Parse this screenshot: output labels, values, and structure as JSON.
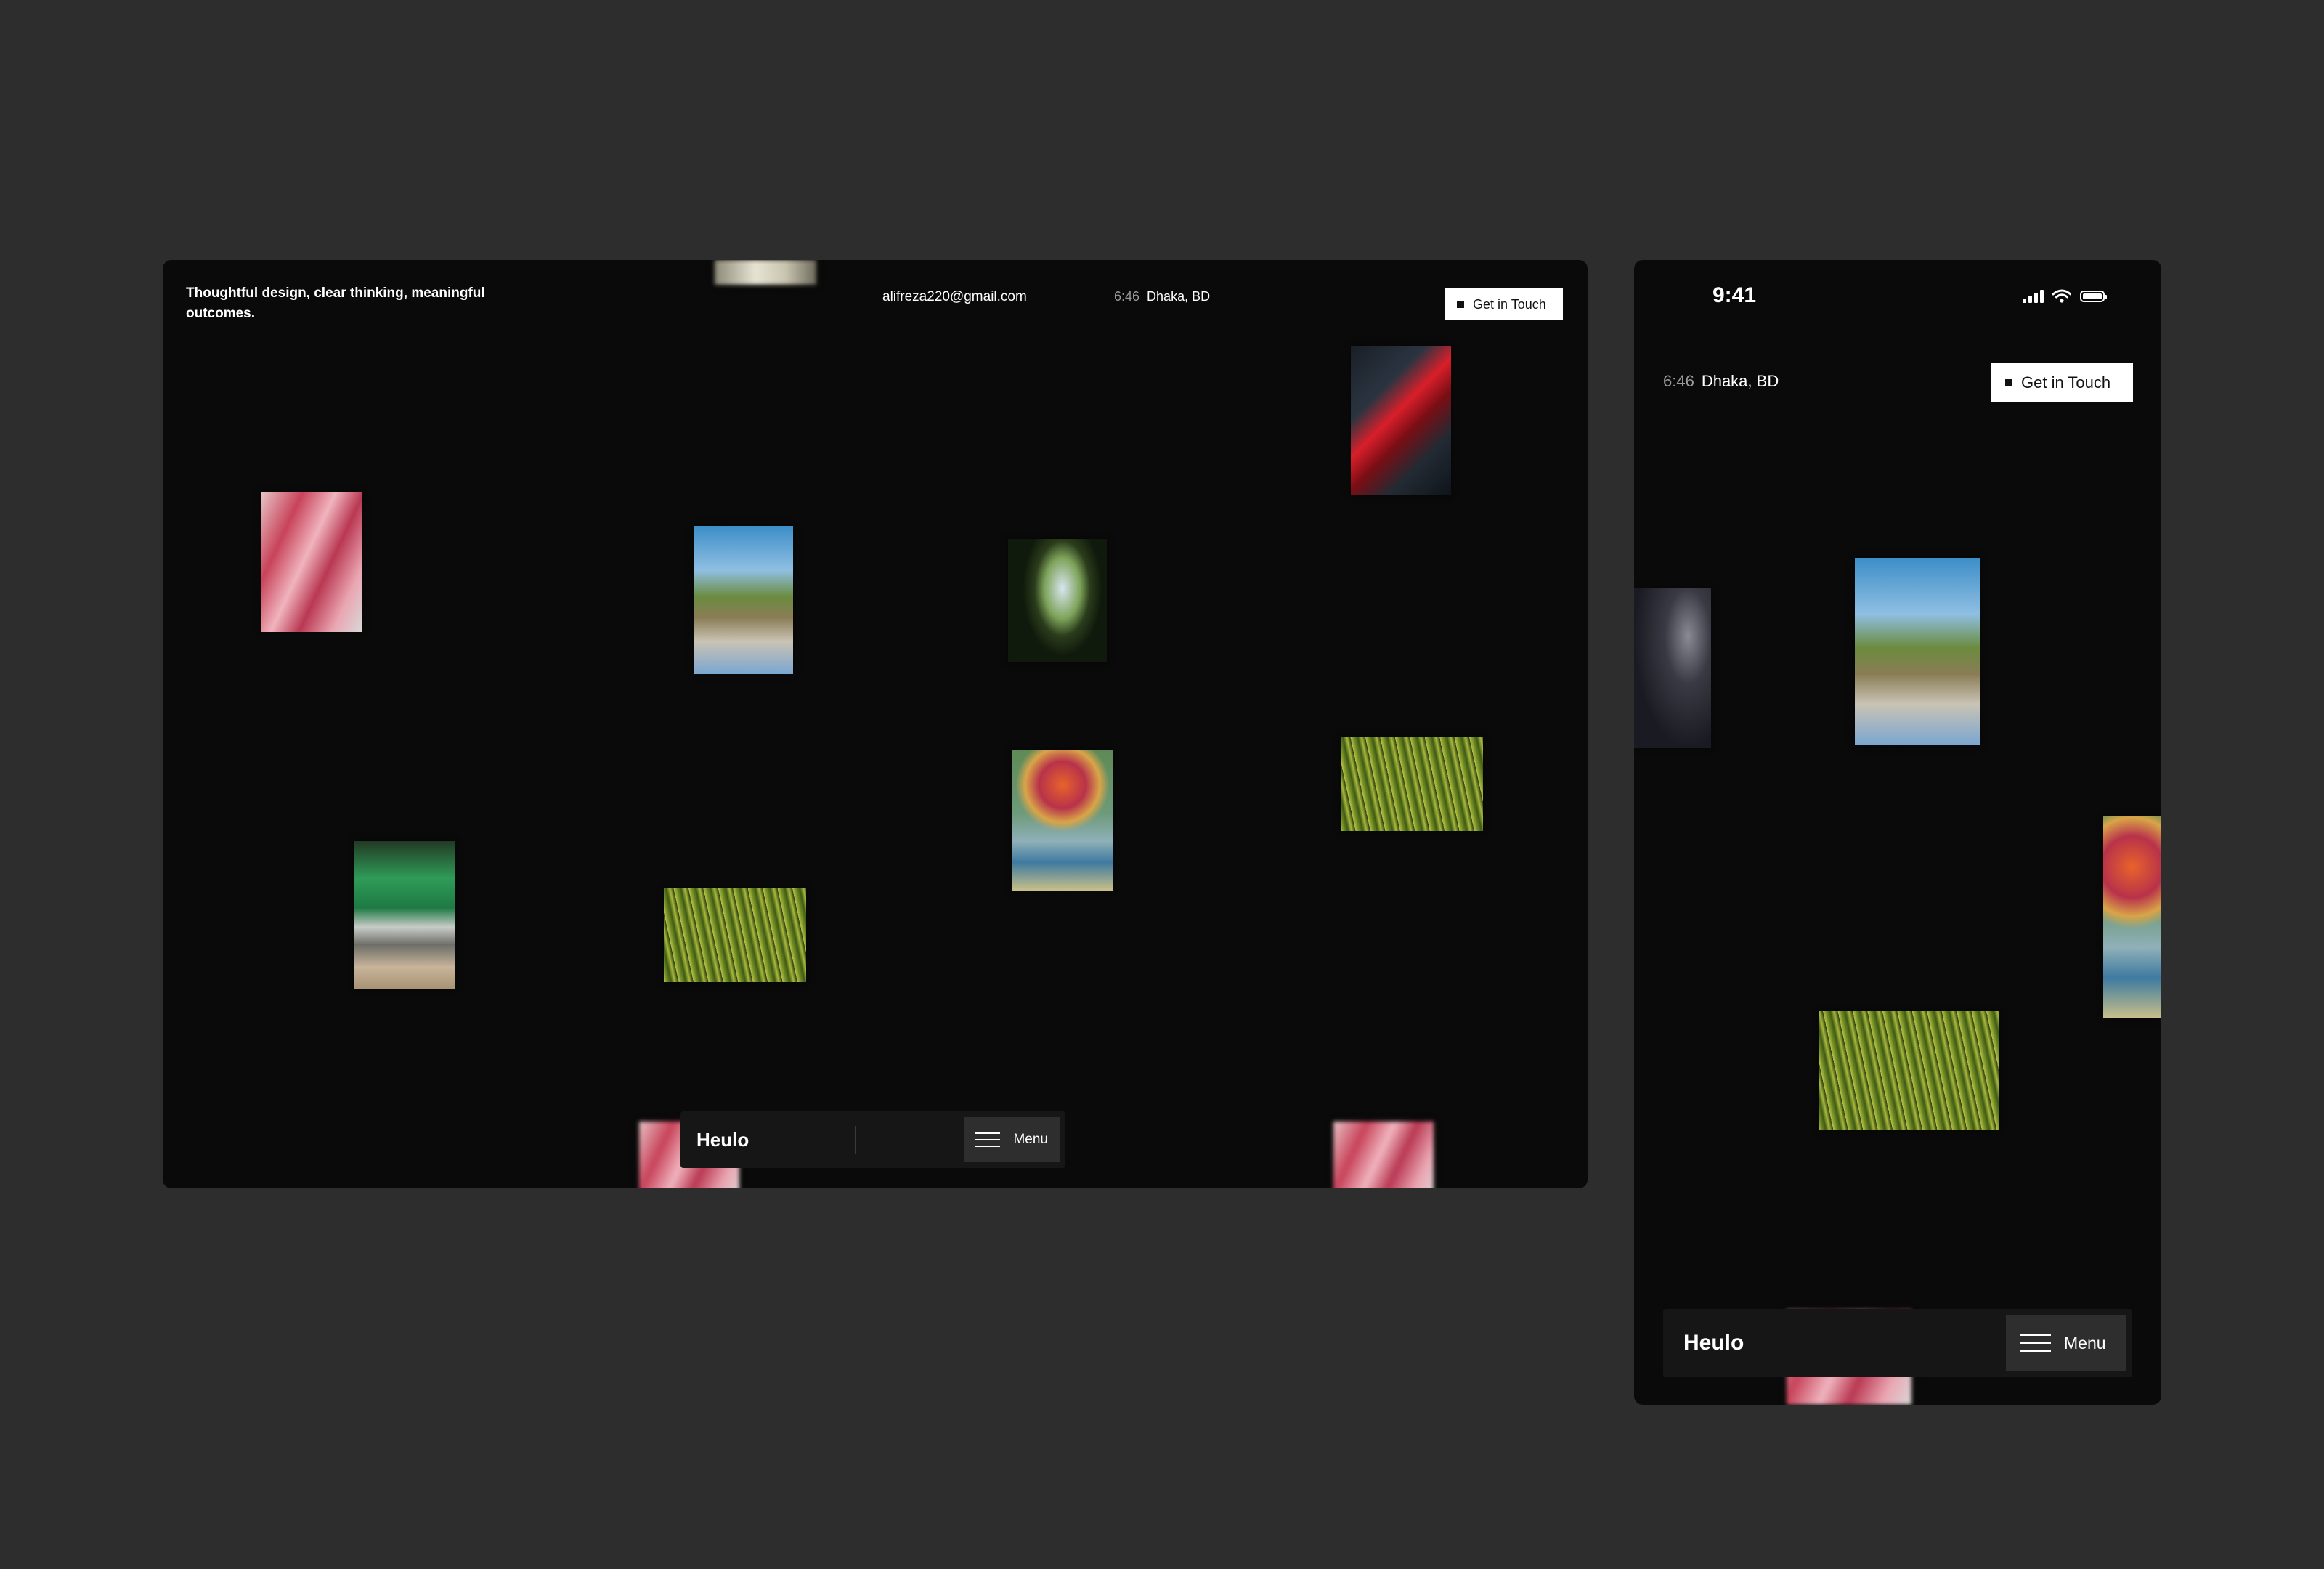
{
  "desktop": {
    "tagline": "Thoughtful design, clear thinking, meaningful outcomes.",
    "email": "alifreza220@gmail.com",
    "time": "6:46",
    "location": "Dhaka, BD",
    "cta_label": "Get in Touch",
    "brand": "Heulo",
    "menu_label": "Menu"
  },
  "mobile": {
    "status_time": "9:41",
    "time": "6:46",
    "location": "Dhaka, BD",
    "cta_label": "Get in Touch",
    "brand": "Heulo",
    "menu_label": "Menu"
  },
  "icons": [
    "cellular-signal-icon",
    "wifi-icon",
    "battery-icon",
    "hamburger-menu-icon"
  ],
  "colors": {
    "page_background": "#2d2d2d",
    "frame_background": "#0a0a0a",
    "cta_background": "#ffffff",
    "menu_background": "#2e2e2e"
  }
}
